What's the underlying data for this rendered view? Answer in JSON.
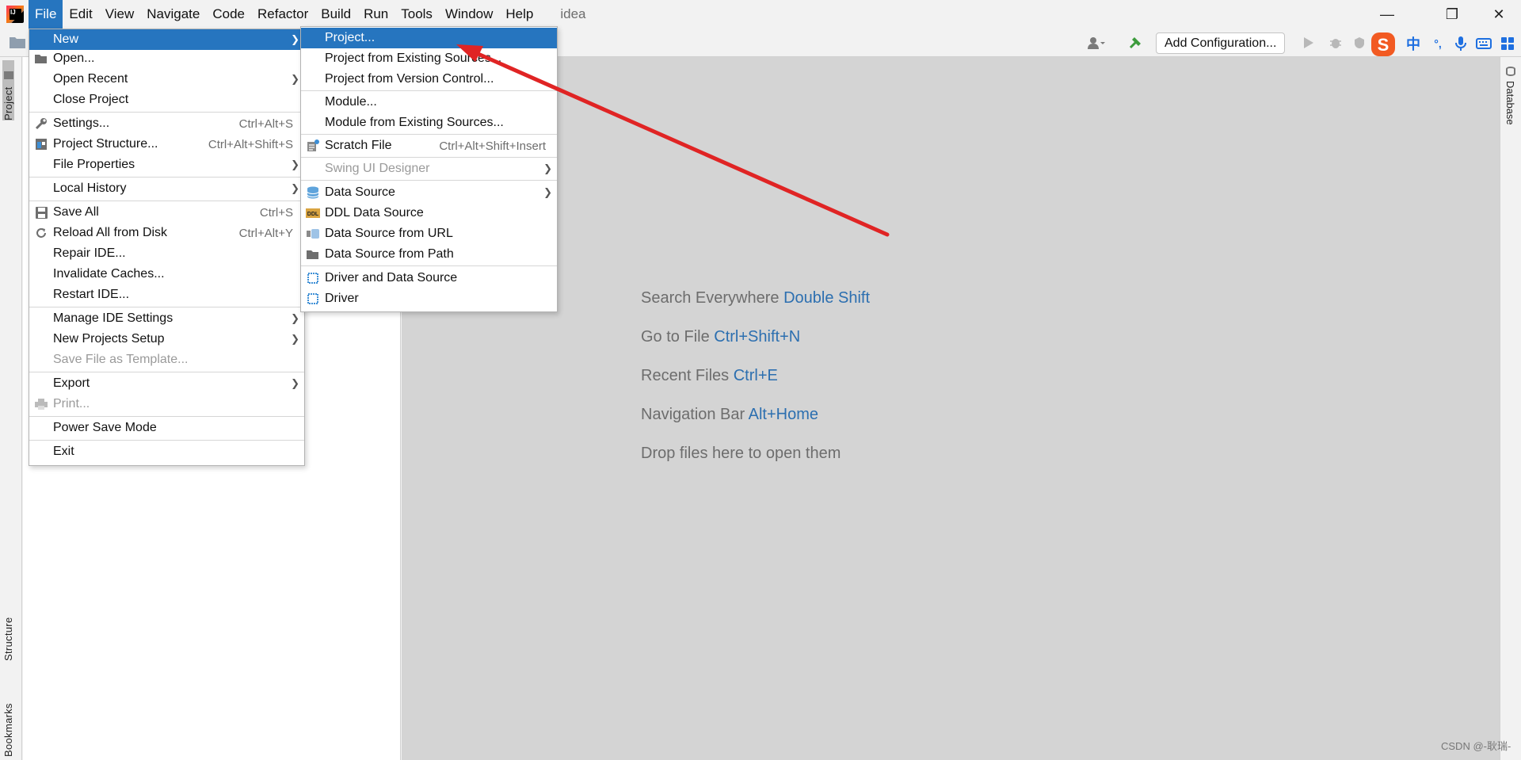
{
  "titlebar": {
    "menus": [
      "File",
      "Edit",
      "View",
      "Navigate",
      "Code",
      "Refactor",
      "Build",
      "Run",
      "Tools",
      "Window",
      "Help"
    ],
    "project_name": "idea",
    "minimize": "—",
    "restore": "❐",
    "close": "✕"
  },
  "toolbar": {
    "add_configuration": "Add Configuration..."
  },
  "left_tabs": {
    "project": "Project",
    "structure": "Structure",
    "bookmarks": "Bookmarks"
  },
  "right_tabs": {
    "database": "Database"
  },
  "file_menu": {
    "items": [
      {
        "label": "New",
        "shortcut": "",
        "submenu": true
      },
      {
        "label": "Open...",
        "shortcut": ""
      },
      {
        "label": "Open Recent",
        "shortcut": "",
        "submenu": true
      },
      {
        "label": "Close Project",
        "shortcut": ""
      },
      {
        "label": "Settings...",
        "shortcut": "Ctrl+Alt+S"
      },
      {
        "label": "Project Structure...",
        "shortcut": "Ctrl+Alt+Shift+S"
      },
      {
        "label": "File Properties",
        "shortcut": "",
        "submenu": true
      },
      {
        "label": "Local History",
        "shortcut": "",
        "submenu": true
      },
      {
        "label": "Save All",
        "shortcut": "Ctrl+S"
      },
      {
        "label": "Reload All from Disk",
        "shortcut": "Ctrl+Alt+Y"
      },
      {
        "label": "Repair IDE...",
        "shortcut": ""
      },
      {
        "label": "Invalidate Caches...",
        "shortcut": ""
      },
      {
        "label": "Restart IDE...",
        "shortcut": ""
      },
      {
        "label": "Manage IDE Settings",
        "shortcut": "",
        "submenu": true
      },
      {
        "label": "New Projects Setup",
        "shortcut": "",
        "submenu": true
      },
      {
        "label": "Save File as Template...",
        "shortcut": "",
        "disabled": true
      },
      {
        "label": "Export",
        "shortcut": "",
        "submenu": true
      },
      {
        "label": "Print...",
        "shortcut": "",
        "disabled": true
      },
      {
        "label": "Power Save Mode",
        "shortcut": ""
      },
      {
        "label": "Exit",
        "shortcut": ""
      }
    ]
  },
  "new_menu": {
    "items": [
      {
        "label": "Project...",
        "shortcut": ""
      },
      {
        "label": "Project from Existing Sources...",
        "shortcut": ""
      },
      {
        "label": "Project from Version Control...",
        "shortcut": ""
      },
      {
        "label": "Module...",
        "shortcut": ""
      },
      {
        "label": "Module from Existing Sources...",
        "shortcut": ""
      },
      {
        "label": "Scratch File",
        "shortcut": "Ctrl+Alt+Shift+Insert"
      },
      {
        "label": "Swing UI Designer",
        "shortcut": "",
        "submenu": true,
        "disabled": true
      },
      {
        "label": "Data Source",
        "shortcut": "",
        "submenu": true
      },
      {
        "label": "DDL Data Source",
        "shortcut": ""
      },
      {
        "label": "Data Source from URL",
        "shortcut": ""
      },
      {
        "label": "Data Source from Path",
        "shortcut": ""
      },
      {
        "label": "Driver and Data Source",
        "shortcut": ""
      },
      {
        "label": "Driver",
        "shortcut": ""
      }
    ]
  },
  "editor_hints": [
    {
      "text": "Search Everywhere",
      "key": "Double Shift"
    },
    {
      "text": "Go to File",
      "key": "Ctrl+Shift+N"
    },
    {
      "text": "Recent Files",
      "key": "Ctrl+E"
    },
    {
      "text": "Navigation Bar",
      "key": "Alt+Home"
    },
    {
      "text": "Drop files here to open them",
      "key": ""
    }
  ],
  "ime": {
    "logo": "S",
    "lang": "中",
    "punct": "°,"
  },
  "watermark": "CSDN @-耿瑞-",
  "colors": {
    "accent": "#2675bf",
    "annotation_arrow": "#e02424",
    "hint_key": "#2c6fb0"
  }
}
